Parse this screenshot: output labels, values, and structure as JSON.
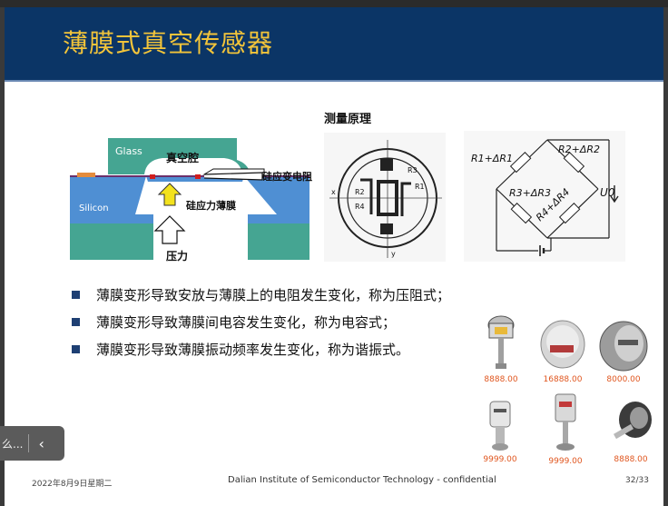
{
  "slide": {
    "title": "薄膜式真空传感器",
    "subtitle": "测量原理",
    "diagram1": {
      "glass": "Glass",
      "chamber": "真空腔",
      "resistor": "硅应变电阻",
      "silicon": "Silicon",
      "membrane": "硅应力薄膜",
      "pressure": "压力"
    },
    "diagram3": {
      "r1": "R1+ΔR1",
      "r2": "R2+ΔR2",
      "r3": "R3+ΔR3",
      "r4": "R4+ΔR4",
      "u0": "U0"
    },
    "bullets": [
      "薄膜变形导致安放与薄膜上的电阻发生变化，称为压阻式；",
      "薄膜变形导致薄膜间电容发生变化，称为电容式；",
      "薄膜变形导致薄膜振动频率发生变化，称为谐振式。"
    ],
    "products": [
      {
        "price": "8888.00"
      },
      {
        "price": "16888.00"
      },
      {
        "price": "8000.00"
      },
      {
        "price": "9999.00"
      },
      {
        "price": "9999.00"
      },
      {
        "price": "8888.00"
      }
    ],
    "footer": {
      "date": "2022年8月9日星期二",
      "center": "Dalian Institute of Semiconductor Technology - confidential",
      "page": "32/33"
    }
  },
  "overlay": {
    "text": "么...",
    "back_icon": "chevron-left-icon"
  },
  "colors": {
    "header": "#0b3566",
    "title": "#f2c43a",
    "price": "#e0561f",
    "bullet": "#1e3f73"
  }
}
